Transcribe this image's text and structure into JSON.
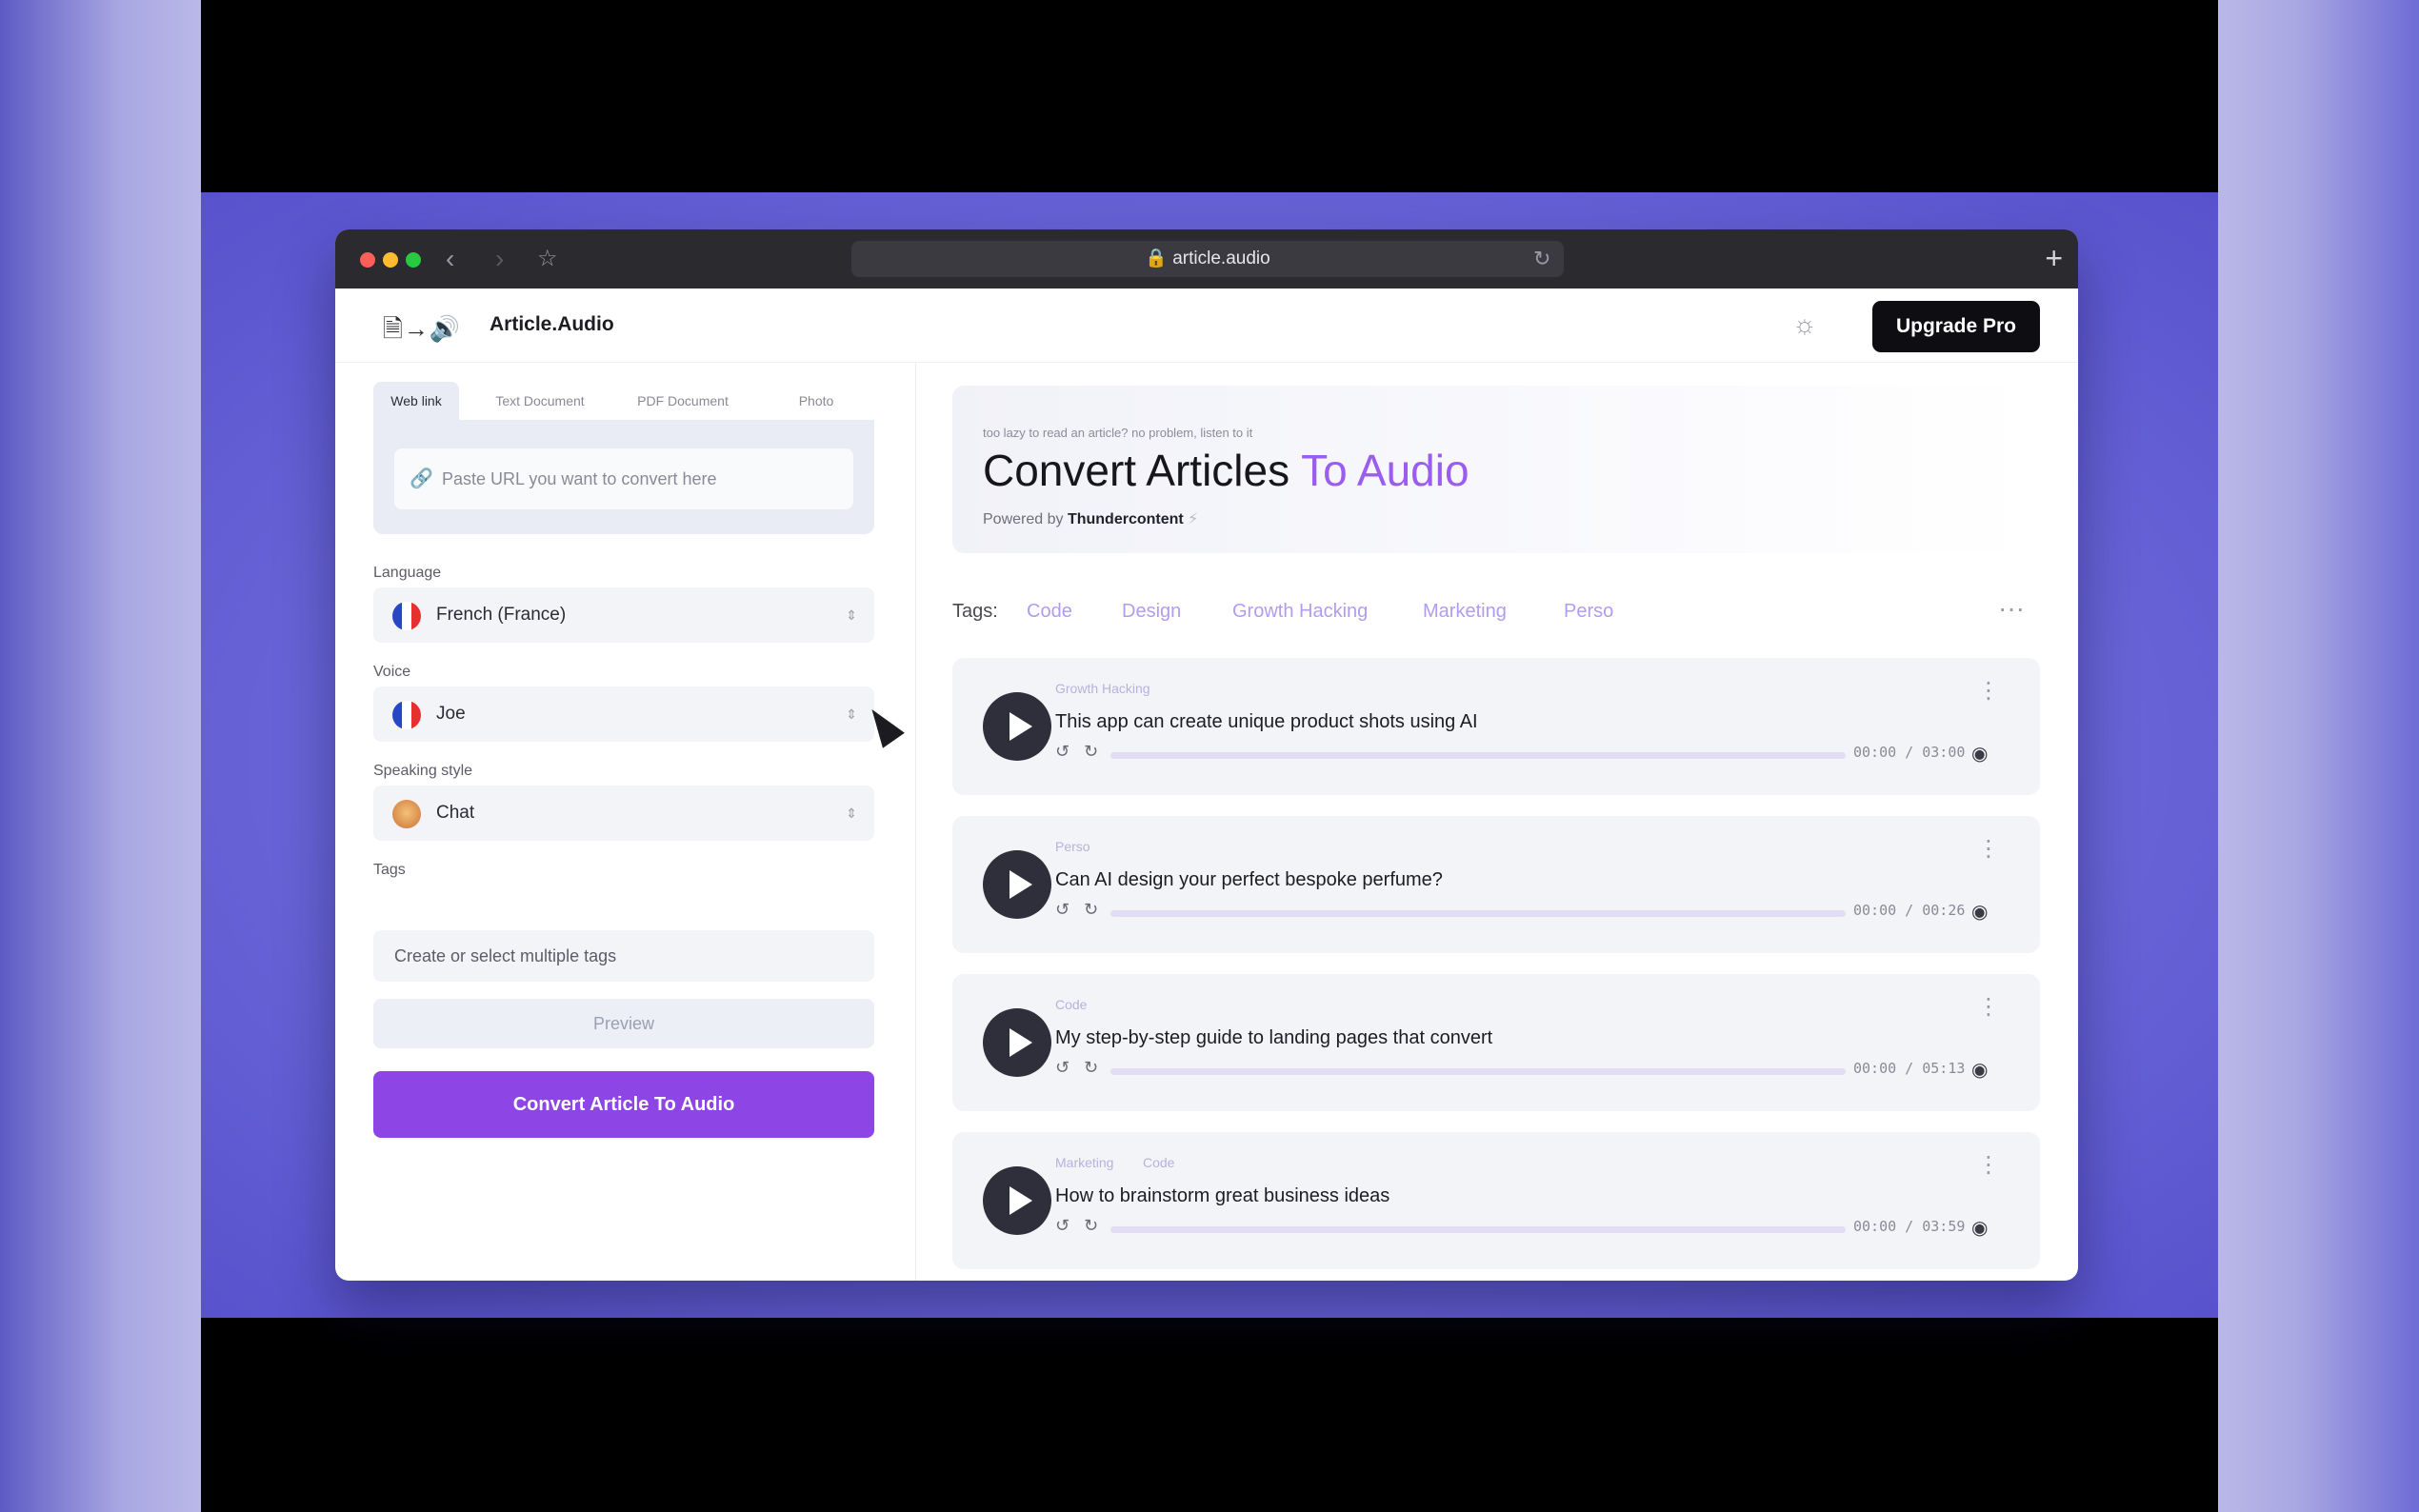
{
  "browser": {
    "url": "article.audio",
    "back_icon": "chevron-left-icon",
    "forward_icon": "chevron-right-icon",
    "bookmark_icon": "star-icon",
    "reload_icon": "reload-icon",
    "new_tab_icon": "plus-icon"
  },
  "header": {
    "logo_glyphs": "🗎→🔊",
    "brand": "Article.Audio",
    "theme_icon": "sun-icon",
    "upgrade_label": "Upgrade Pro"
  },
  "source_tabs": [
    {
      "label": "Web link",
      "active": true
    },
    {
      "label": "Text Document",
      "active": false
    },
    {
      "label": "PDF Document",
      "active": false
    },
    {
      "label": "Photo",
      "active": false
    }
  ],
  "url_input": {
    "placeholder": "Paste URL you want to convert here"
  },
  "form": {
    "language_label": "Language",
    "language_value": "French (France)",
    "voice_label": "Voice",
    "voice_value": "Joe",
    "style_label": "Speaking style",
    "style_value": "Chat",
    "tags_label": "Tags",
    "tags_placeholder": "Create or select multiple tags",
    "preview_label": "Preview",
    "convert_label": "Convert Article To Audio"
  },
  "hero": {
    "subtitle": "too lazy to read an article? no problem, listen to it",
    "title_main": "Convert Articles ",
    "title_accent": "To Audio",
    "powered_prefix": "Powered by",
    "powered_brand": "Thundercontent"
  },
  "tags_filter": {
    "label": "Tags:",
    "items": [
      "Code",
      "Design",
      "Growth Hacking",
      "Marketing",
      "Perso"
    ]
  },
  "articles": [
    {
      "tags": [
        "Growth Hacking"
      ],
      "title": "This app can create unique product shots using AI",
      "time": "00:00 / 03:00"
    },
    {
      "tags": [
        "Perso"
      ],
      "title": "Can AI design your perfect bespoke perfume?",
      "time": "00:00 / 00:26"
    },
    {
      "tags": [
        "Code"
      ],
      "title": "My step-by-step guide to landing pages that convert",
      "time": "00:00 / 05:13"
    },
    {
      "tags": [
        "Marketing",
        "Code"
      ],
      "title": "How to brainstorm great business ideas",
      "time": "00:00 / 03:59"
    }
  ],
  "colors": {
    "accent": "#9b5cf0",
    "convert_button": "#8e45e6",
    "upgrade_button": "#0d0d12"
  }
}
